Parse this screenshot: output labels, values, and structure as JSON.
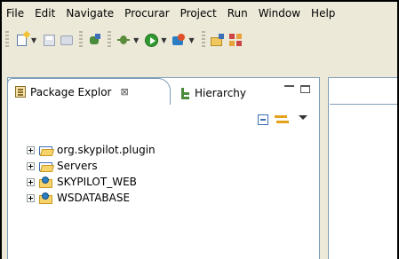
{
  "menu": [
    "File",
    "Edit",
    "Navigate",
    "Procurar",
    "Project",
    "Run",
    "Window",
    "Help"
  ],
  "toolbar": {
    "icons": [
      "new-wizard-icon",
      "save-icon",
      "print-icon",
      "debug-task-icon",
      "debug-icon",
      "run-icon",
      "external-tools-icon",
      "new-project-icon",
      "grid-icon"
    ]
  },
  "view": {
    "tabs": [
      {
        "label": "Package Explor",
        "icon": "package-explorer-icon",
        "close": "⊠",
        "active": true
      },
      {
        "label": "Hierarchy",
        "icon": "hierarchy-icon",
        "active": false
      }
    ]
  },
  "tree": [
    {
      "label": "org.skypilot.plugin",
      "icon": "folder-icon"
    },
    {
      "label": "Servers",
      "icon": "folder-icon"
    },
    {
      "label": "SKYPILOT_WEB",
      "icon": "web-project-icon"
    },
    {
      "label": "WSDATABASE",
      "icon": "web-project-icon"
    }
  ]
}
